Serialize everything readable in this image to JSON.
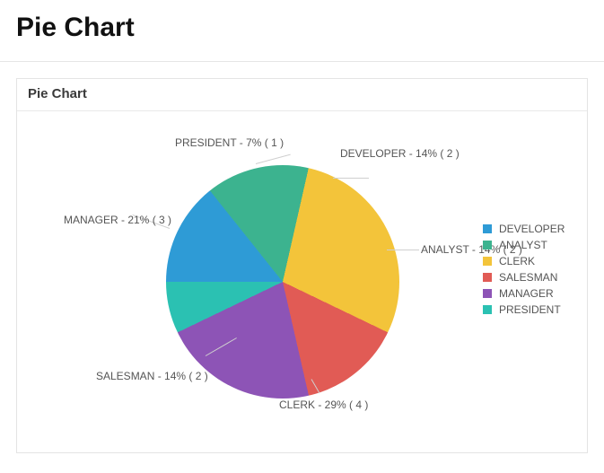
{
  "page": {
    "title": "Pie Chart"
  },
  "region": {
    "title": "Pie Chart"
  },
  "chart_data": {
    "type": "pie",
    "title": "",
    "series": [
      {
        "name": "DEVELOPER",
        "value": 2,
        "percent": 14,
        "color": "#2e9bd6"
      },
      {
        "name": "ANALYST",
        "value": 2,
        "percent": 14,
        "color": "#3cb38f"
      },
      {
        "name": "CLERK",
        "value": 4,
        "percent": 29,
        "color": "#f3c43a"
      },
      {
        "name": "SALESMAN",
        "value": 2,
        "percent": 14,
        "color": "#e15b55"
      },
      {
        "name": "MANAGER",
        "value": 3,
        "percent": 21,
        "color": "#8d54b6"
      },
      {
        "name": "PRESIDENT",
        "value": 1,
        "percent": 7,
        "color": "#2bc1b2"
      }
    ],
    "legend_position": "right"
  },
  "slice_labels": {
    "s0": "DEVELOPER - 14% ( 2 )",
    "s1": "ANALYST - 14% ( 2 )",
    "s2": "CLERK - 29% ( 4 )",
    "s3": "SALESMAN - 14% ( 2 )",
    "s4": "MANAGER - 21% ( 3 )",
    "s5": "PRESIDENT - 7% ( 1 )"
  },
  "legend": {
    "l0": "DEVELOPER",
    "l1": "ANALYST",
    "l2": "CLERK",
    "l3": "SALESMAN",
    "l4": "MANAGER",
    "l5": "PRESIDENT"
  },
  "colors": {
    "c0": "#2e9bd6",
    "c1": "#3cb38f",
    "c2": "#f3c43a",
    "c3": "#e15b55",
    "c4": "#8d54b6",
    "c5": "#2bc1b2"
  }
}
